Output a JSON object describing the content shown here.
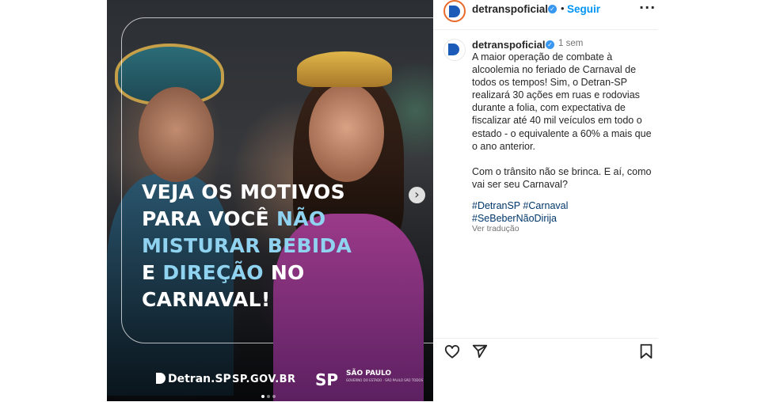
{
  "media": {
    "headline": {
      "line1": "VEJA OS MOTIVOS",
      "line2_plain": "PARA VOCÊ ",
      "line2_highlight": "NÃO",
      "line3_highlight": "MISTURAR BEBIDA",
      "line4_plain_a": "E ",
      "line4_highlight": "DIREÇÃO",
      "line4_plain_b": " NO",
      "line5": "CARNAVAL!"
    },
    "highlight_color": "#8fd3f0",
    "next_icon": "chevron-right-icon",
    "logos": {
      "detran": "Detran.SP",
      "spgov": "SP.GOV.BR",
      "sp": "SP",
      "sp_name": "SÃO PAULO",
      "sp_sub": "GOVERNO DO ESTADO · SÃO PAULO SÃO TODOS"
    },
    "carousel": {
      "total": 3,
      "active": 0
    }
  },
  "header": {
    "username": "detranspoficial",
    "dot": "•",
    "follow_label": "Seguir",
    "more_icon": "more-horizontal-icon",
    "verified": true
  },
  "caption": {
    "username": "detranspoficial",
    "time": "1 sem",
    "paragraph1": "A maior operação de combate à alcoolemia no feriado de Carnaval de todos os tempos! Sim, o Detran-SP realizará 30 ações em ruas e rodovias durante a folia, com expectativa de fiscalizar até 40 mil veículos em todo o estado - o equivalente a 60% a mais que o ano anterior.",
    "paragraph2": "Com o trânsito não se brinca. E aí, como vai ser seu Carnaval?",
    "hashtags": [
      "#DetranSP",
      "#Carnaval",
      "#SeBeberNãoDirija"
    ],
    "see_translation": "Ver tradução"
  },
  "actions": {
    "like_icon": "heart-icon",
    "share_icon": "paper-plane-icon",
    "save_icon": "bookmark-icon"
  },
  "colors": {
    "link": "#0095f6",
    "hashtag": "#00376b",
    "muted": "#737373",
    "text": "#262626",
    "brand": "#1c5bb8"
  }
}
